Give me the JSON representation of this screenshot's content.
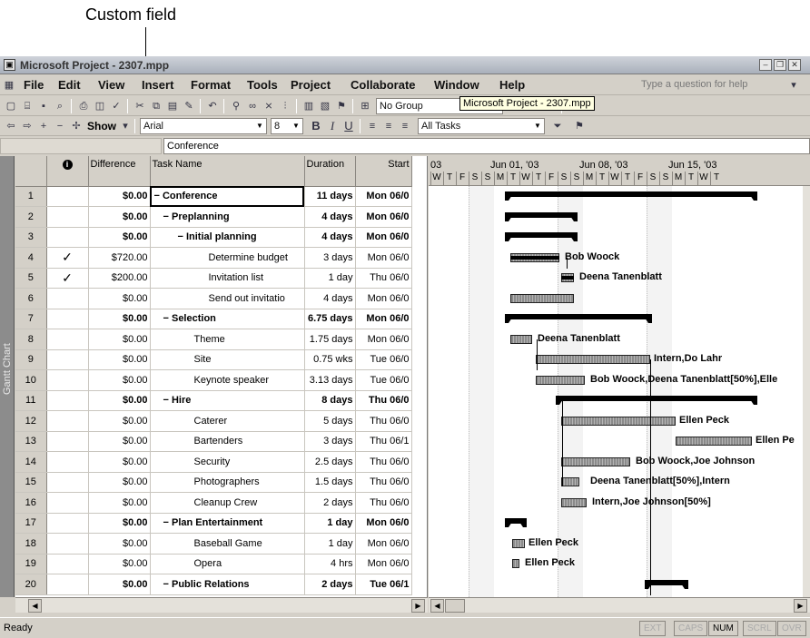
{
  "callout": {
    "label": "Custom field"
  },
  "window": {
    "title": "Microsoft Project - 2307.mpp",
    "tooltip": "Microsoft Project - 2307.mpp"
  },
  "menu": [
    "File",
    "Edit",
    "View",
    "Insert",
    "Format",
    "Tools",
    "Project",
    "Collaborate",
    "Window",
    "Help"
  ],
  "help": {
    "placeholder": "Type a question for help"
  },
  "toolbar1": {
    "group": "No Group"
  },
  "toolbar2": {
    "show": "Show",
    "font": "Arial",
    "size": "8",
    "bold": "B",
    "italic": "I",
    "underline": "U",
    "filter": "All Tasks"
  },
  "editbar": {
    "value": "Conference"
  },
  "view": {
    "label": "Gantt Chart"
  },
  "table": {
    "headers": {
      "id": "",
      "ind": "i",
      "diff": "Difference",
      "name": "Task Name",
      "dur": "Duration",
      "start": "Start"
    },
    "rows": [
      {
        "id": "1",
        "ind": "",
        "diff": "$0.00",
        "name": "− Conference",
        "dur": "11 days",
        "start": "Mon 06/0",
        "sum": true
      },
      {
        "id": "2",
        "ind": "",
        "diff": "$0.00",
        "name": "− Preplanning",
        "dur": "4 days",
        "start": "Mon 06/0",
        "sum": true
      },
      {
        "id": "3",
        "ind": "",
        "diff": "$0.00",
        "name": "− Initial planning",
        "dur": "4 days",
        "start": "Mon 06/0",
        "sum": true
      },
      {
        "id": "4",
        "ind": "✓",
        "diff": "$720.00",
        "name": "Determine budget",
        "dur": "3 days",
        "start": "Mon 06/0",
        "sum": false
      },
      {
        "id": "5",
        "ind": "✓",
        "diff": "$200.00",
        "name": "Invitation list",
        "dur": "1 day",
        "start": "Thu 06/0",
        "sum": false
      },
      {
        "id": "6",
        "ind": "",
        "diff": "$0.00",
        "name": "Send out invitatio",
        "dur": "4 days",
        "start": "Mon 06/0",
        "sum": false
      },
      {
        "id": "7",
        "ind": "",
        "diff": "$0.00",
        "name": "− Selection",
        "dur": "6.75 days",
        "start": "Mon 06/0",
        "sum": true
      },
      {
        "id": "8",
        "ind": "",
        "diff": "$0.00",
        "name": "Theme",
        "dur": "1.75 days",
        "start": "Mon 06/0",
        "sum": false
      },
      {
        "id": "9",
        "ind": "",
        "diff": "$0.00",
        "name": "Site",
        "dur": "0.75 wks",
        "start": "Tue 06/0",
        "sum": false
      },
      {
        "id": "10",
        "ind": "",
        "diff": "$0.00",
        "name": "Keynote speaker",
        "dur": "3.13 days",
        "start": "Tue 06/0",
        "sum": false
      },
      {
        "id": "11",
        "ind": "",
        "diff": "$0.00",
        "name": "− Hire",
        "dur": "8 days",
        "start": "Thu 06/0",
        "sum": true
      },
      {
        "id": "12",
        "ind": "",
        "diff": "$0.00",
        "name": "Caterer",
        "dur": "5 days",
        "start": "Thu 06/0",
        "sum": false
      },
      {
        "id": "13",
        "ind": "",
        "diff": "$0.00",
        "name": "Bartenders",
        "dur": "3 days",
        "start": "Thu 06/1",
        "sum": false
      },
      {
        "id": "14",
        "ind": "",
        "diff": "$0.00",
        "name": "Security",
        "dur": "2.5 days",
        "start": "Thu 06/0",
        "sum": false
      },
      {
        "id": "15",
        "ind": "",
        "diff": "$0.00",
        "name": "Photographers",
        "dur": "1.5 days",
        "start": "Thu 06/0",
        "sum": false
      },
      {
        "id": "16",
        "ind": "",
        "diff": "$0.00",
        "name": "Cleanup Crew",
        "dur": "2 days",
        "start": "Thu 06/0",
        "sum": false
      },
      {
        "id": "17",
        "ind": "",
        "diff": "$0.00",
        "name": "− Plan Entertainment",
        "dur": "1 day",
        "start": "Mon 06/0",
        "sum": true
      },
      {
        "id": "18",
        "ind": "",
        "diff": "$0.00",
        "name": "Baseball Game",
        "dur": "1 day",
        "start": "Mon 06/0",
        "sum": false
      },
      {
        "id": "19",
        "ind": "",
        "diff": "$0.00",
        "name": "Opera",
        "dur": "4 hrs",
        "start": "Mon 06/0",
        "sum": false
      },
      {
        "id": "20",
        "ind": "",
        "diff": "$0.00",
        "name": "− Public Relations",
        "dur": "2 days",
        "start": "Tue 06/1",
        "sum": true
      }
    ]
  },
  "gantt": {
    "weeks": [
      "03",
      "Jun 01, '03",
      "Jun 08, '03",
      "Jun 15, '03"
    ],
    "days": [
      "W",
      "T",
      "F",
      "S",
      "S",
      "M",
      "T",
      "W",
      "T",
      "F",
      "S",
      "S",
      "M",
      "T",
      "W",
      "T",
      "F",
      "S",
      "S",
      "M",
      "T",
      "W",
      "T"
    ],
    "labels": [
      "Bob Woock",
      "Deena Tanenblatt",
      "Deena Tanenblatt",
      "Intern,Do Lahr",
      "Bob Woock,Deena Tanenblatt[50%],Elle",
      "Ellen Peck",
      "Ellen Pe",
      "Bob Woock,Joe Johnson",
      "Deena Tanenblatt[50%],Intern",
      "Intern,Joe Johnson[50%]",
      "Ellen Peck",
      "Ellen Peck"
    ]
  },
  "status": {
    "text": "Ready",
    "indicators": [
      "EXT",
      "CAPS",
      "NUM",
      "SCRL",
      "OVR"
    ],
    "active": "NUM"
  }
}
